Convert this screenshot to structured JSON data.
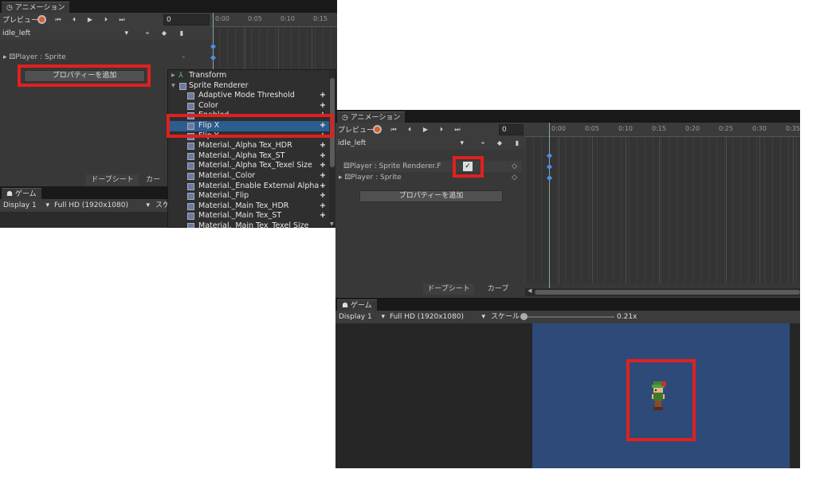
{
  "left": {
    "anim_tab": "アニメーション",
    "preview": "プレビュー",
    "frame": "0",
    "clip": "idle_left",
    "ticks": [
      "0:00",
      "0:05",
      "0:10",
      "0:15"
    ],
    "property_row": "Player : Sprite",
    "add_property": "プロパティーを追加",
    "dopesheet": "ドープシート",
    "curves": "カー",
    "game_tab": "ゲーム",
    "display": "Display 1",
    "resolution": "Full HD (1920x1080)",
    "scale_partial": "スケ"
  },
  "menu": {
    "transform": "Transform",
    "sprite_renderer": "Sprite Renderer",
    "items": [
      "Adaptive Mode Threshold",
      "Color",
      "Enabled",
      "Flip X",
      "Flip Y",
      "Material._Alpha Tex_HDR",
      "Material._Alpha Tex_ST",
      "Material._Alpha Tex_Texel Size",
      "Material._Color",
      "Material._Enable External Alpha",
      "Material._Flip",
      "Material._Main Tex_HDR",
      "Material._Main Tex_ST",
      "Material._Main Tex_Texel Size"
    ],
    "selected": "Flip X",
    "plus": "+"
  },
  "right": {
    "anim_tab": "アニメーション",
    "preview": "プレビュー",
    "frame": "0",
    "clip": "idle_left",
    "ticks": [
      "0:00",
      "0:05",
      "0:10",
      "0:15",
      "0:20",
      "0:25",
      "0:30",
      "0:35"
    ],
    "row1": "Player : Sprite Renderer.F",
    "check": "✓",
    "row2": "Player : Sprite",
    "add_property": "プロパティーを追加",
    "dopesheet": "ドープシート",
    "curves": "カーブ",
    "game_tab": "ゲーム",
    "display": "Display 1",
    "resolution": "Full HD (1920x1080)",
    "scale": "スケール",
    "scale_value": "0.21x"
  },
  "colors": {
    "panel": "#383838",
    "highlight": "#2c5d8f",
    "annotation": "#e02020",
    "game_bg": "#2e4a78"
  }
}
